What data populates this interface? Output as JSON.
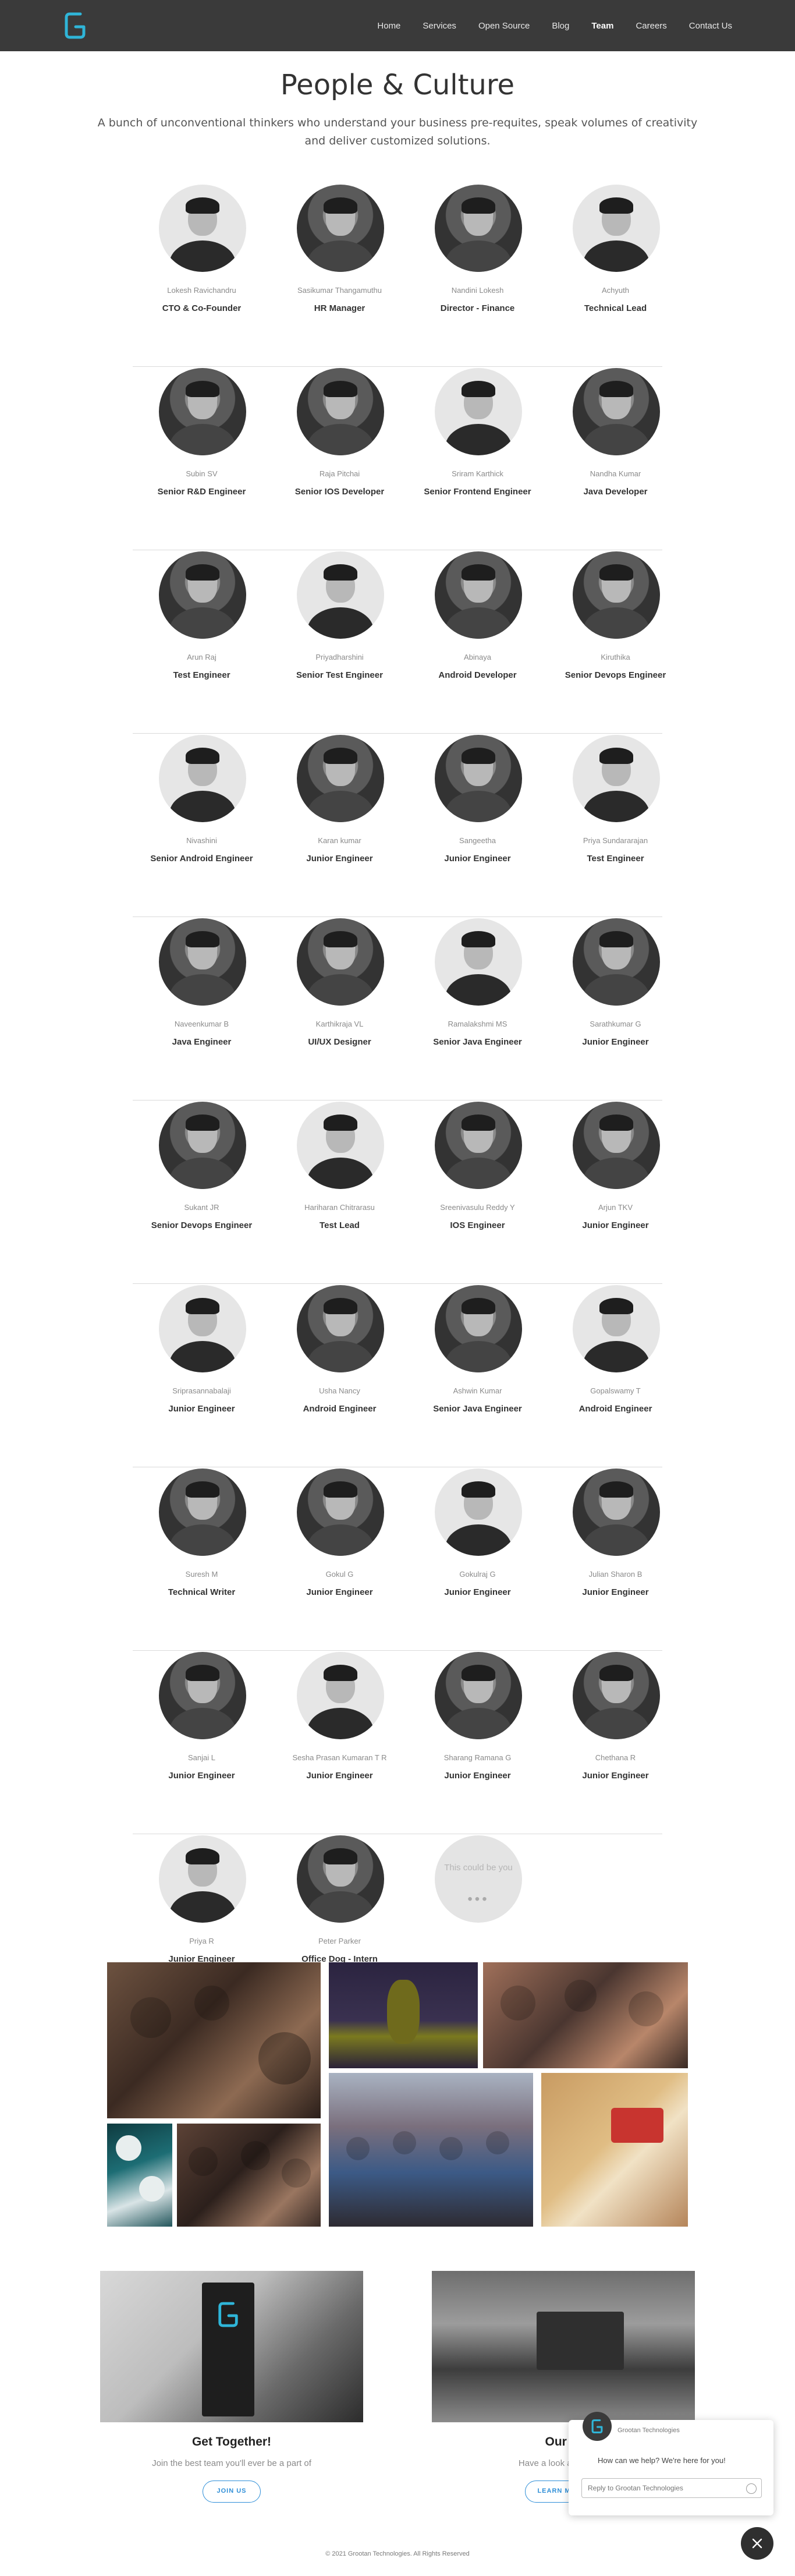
{
  "nav": {
    "logo_letter": "G",
    "items": [
      "Home",
      "Services",
      "Open Source",
      "Blog",
      "Team",
      "Careers",
      "Contact Us"
    ],
    "active": "Team"
  },
  "hero": {
    "title": "People & Culture",
    "subtitle": "A bunch of unconventional thinkers who understand your business pre-requites, speak volumes of creativity and deliver customized solutions."
  },
  "team": [
    [
      {
        "name": "Lokesh Ravichandru",
        "role": "CTO & Co-Founder"
      },
      {
        "name": "Sasikumar Thangamuthu",
        "role": "HR Manager"
      },
      {
        "name": "Nandini Lokesh",
        "role": "Director - Finance"
      },
      {
        "name": "Achyuth",
        "role": "Technical Lead"
      }
    ],
    [
      {
        "name": "Subin SV",
        "role": "Senior R&D Engineer"
      },
      {
        "name": "Raja Pitchai",
        "role": "Senior IOS Developer"
      },
      {
        "name": "Sriram Karthick",
        "role": "Senior Frontend Engineer"
      },
      {
        "name": "Nandha Kumar",
        "role": "Java Developer"
      }
    ],
    [
      {
        "name": "Arun Raj",
        "role": "Test Engineer"
      },
      {
        "name": "Priyadharshini",
        "role": "Senior Test Engineer"
      },
      {
        "name": "Abinaya",
        "role": "Android Developer"
      },
      {
        "name": "Kiruthika",
        "role": "Senior Devops Engineer"
      }
    ],
    [
      {
        "name": "Nivashini",
        "role": "Senior Android Engineer"
      },
      {
        "name": "Karan kumar",
        "role": "Junior Engineer"
      },
      {
        "name": "Sangeetha",
        "role": "Junior Engineer"
      },
      {
        "name": "Priya Sundararajan",
        "role": "Test Engineer"
      }
    ],
    [
      {
        "name": "Naveenkumar B",
        "role": "Java Engineer"
      },
      {
        "name": "Karthikraja VL",
        "role": "UI/UX Designer"
      },
      {
        "name": "Ramalakshmi MS",
        "role": "Senior Java Engineer"
      },
      {
        "name": "Sarathkumar G",
        "role": "Junior Engineer"
      }
    ],
    [
      {
        "name": "Sukant JR",
        "role": "Senior Devops Engineer"
      },
      {
        "name": "Hariharan Chitrarasu",
        "role": "Test Lead"
      },
      {
        "name": "Sreenivasulu Reddy Y",
        "role": "IOS Engineer"
      },
      {
        "name": "Arjun TKV",
        "role": "Junior Engineer"
      }
    ],
    [
      {
        "name": "Sriprasannabalaji",
        "role": "Junior Engineer"
      },
      {
        "name": "Usha Nancy",
        "role": "Android Engineer"
      },
      {
        "name": "Ashwin Kumar",
        "role": "Senior Java Engineer"
      },
      {
        "name": "Gopalswamy T",
        "role": "Android Engineer"
      }
    ],
    [
      {
        "name": "Suresh M",
        "role": "Technical Writer"
      },
      {
        "name": "Gokul G",
        "role": "Junior Engineer"
      },
      {
        "name": "Gokulraj G",
        "role": "Junior Engineer"
      },
      {
        "name": "Julian Sharon B",
        "role": "Junior Engineer"
      }
    ],
    [
      {
        "name": "Sanjai L",
        "role": "Junior Engineer"
      },
      {
        "name": "Sesha Prasan Kumaran T R",
        "role": "Junior Engineer"
      },
      {
        "name": "Sharang Ramana G",
        "role": "Junior Engineer"
      },
      {
        "name": "Chethana R",
        "role": "Junior Engineer"
      }
    ],
    [
      {
        "name": "Priya R",
        "role": "Junior Engineer"
      },
      {
        "name": "Peter Parker",
        "role": "Office Dog - Intern"
      }
    ]
  ],
  "placeholder": {
    "text": "This could be you",
    "dots": "•••"
  },
  "cards": {
    "left": {
      "title": "Get Together!",
      "subtitle": "Join the best team you'll ever be a part of",
      "button": "JOIN US"
    },
    "right": {
      "title": "Our W",
      "subtitle": "Have a look at our outc",
      "button": "LEARN M"
    }
  },
  "footer": "© 2021 Grootan Technologies. All Rights Reserved",
  "chat": {
    "company": "Grootan Technologies",
    "message": "How can we help? We're here for you!",
    "placeholder": "Reply to Grootan Technologies"
  },
  "colors": {
    "header": "#3a3a3a",
    "accent": "#2f8fd8",
    "logo": "#2fb5d8"
  }
}
